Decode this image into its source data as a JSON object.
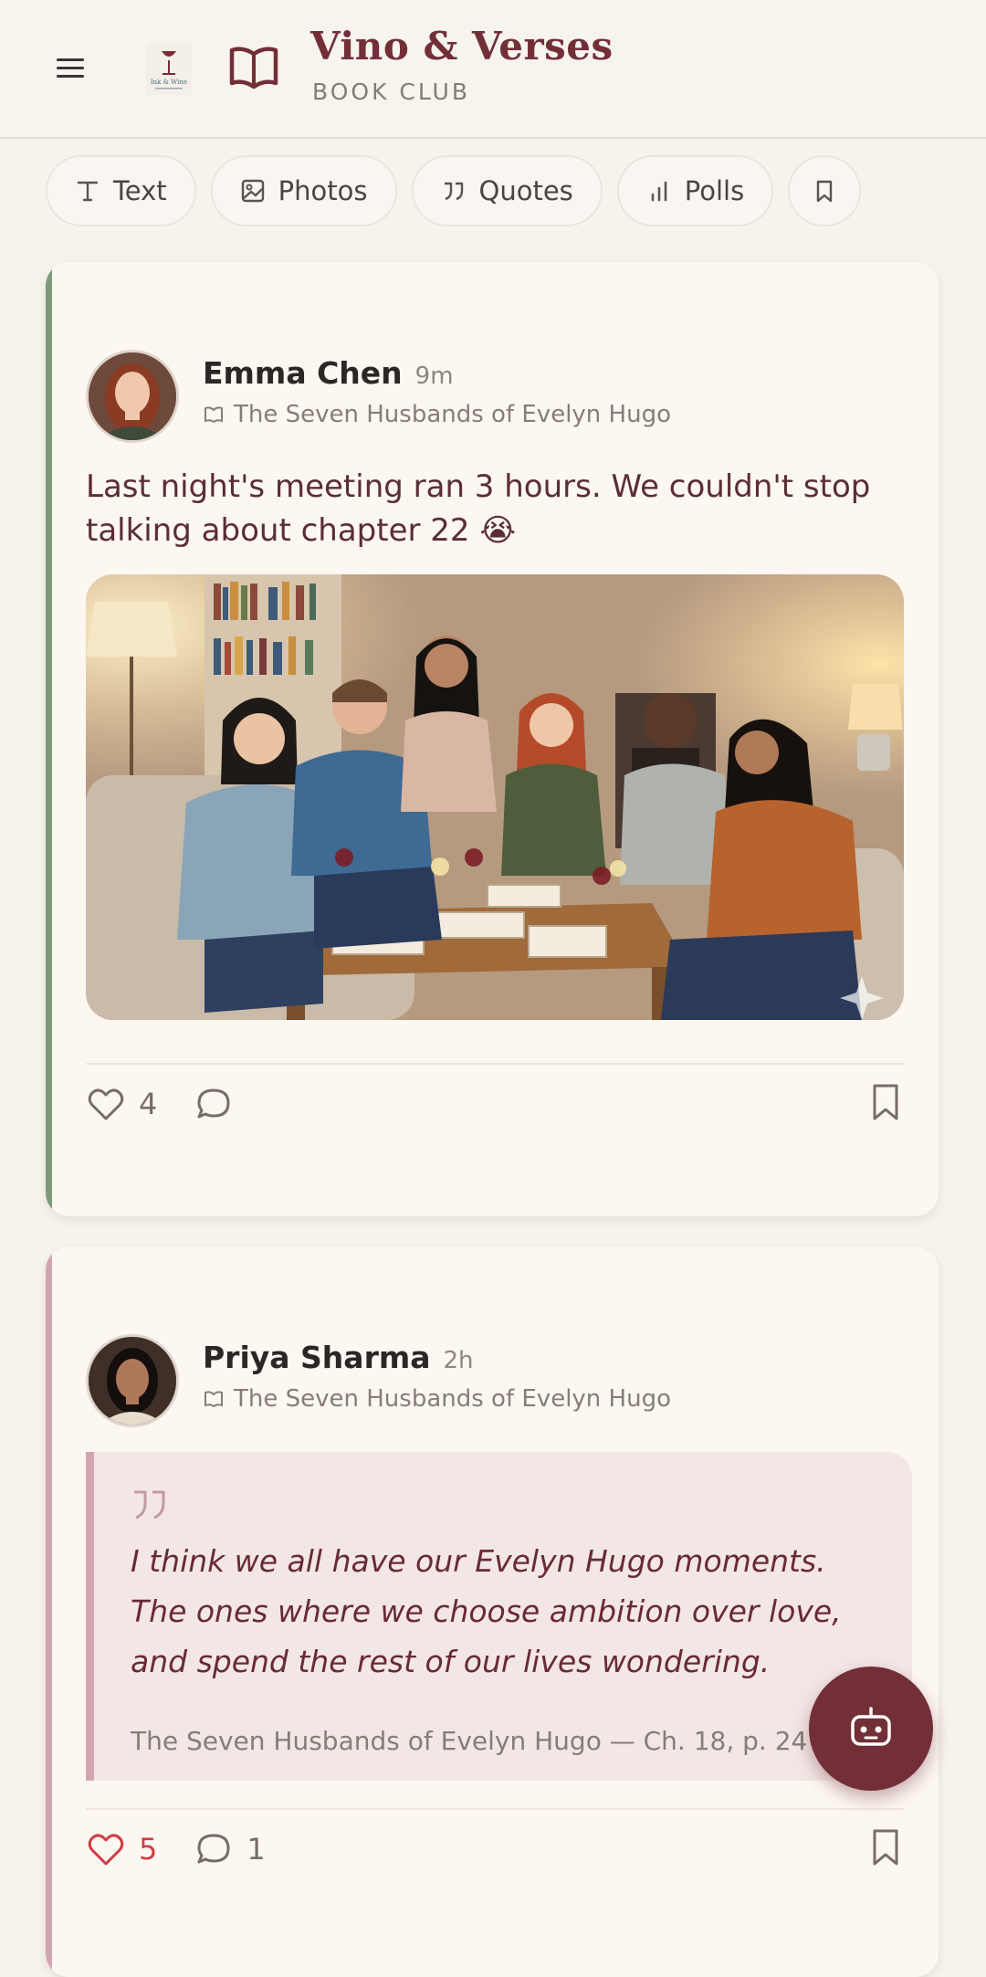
{
  "header": {
    "title": "Vino & Verses",
    "subtitle": "BOOK CLUB",
    "logo_text": "Ink & Wine"
  },
  "filters": [
    {
      "label": "Text",
      "icon": "text-icon"
    },
    {
      "label": "Photos",
      "icon": "image-icon"
    },
    {
      "label": "Quotes",
      "icon": "quote-icon"
    },
    {
      "label": "Polls",
      "icon": "bar-chart-icon"
    },
    {
      "label": "",
      "icon": "bookmark-icon"
    }
  ],
  "posts": [
    {
      "author": "Emma Chen",
      "time": "9m",
      "book": "The Seven Husbands of Evelyn Hugo",
      "text": "Last night's meeting ran 3 hours. We couldn't stop talking about chapter 22 😭",
      "likes": "4",
      "comments": "",
      "liked": false,
      "accent": "#7e9a78"
    },
    {
      "author": "Priya Sharma",
      "time": "2h",
      "book": "The Seven Husbands of Evelyn Hugo",
      "quote": "I think we all have our Evelyn Hugo moments. The ones where we choose ambition over love, and spend the rest of our lives wondering.",
      "quote_source": "The Seven Husbands of Evelyn Hugo — Ch. 18, p. 247",
      "likes": "5",
      "comments": "1",
      "liked": true,
      "accent": "#d2a6b0"
    }
  ],
  "colors": {
    "brand": "#722f37",
    "background": "#f6f2ec",
    "card": "#fdf7f1",
    "like_active": "#d23b44"
  }
}
